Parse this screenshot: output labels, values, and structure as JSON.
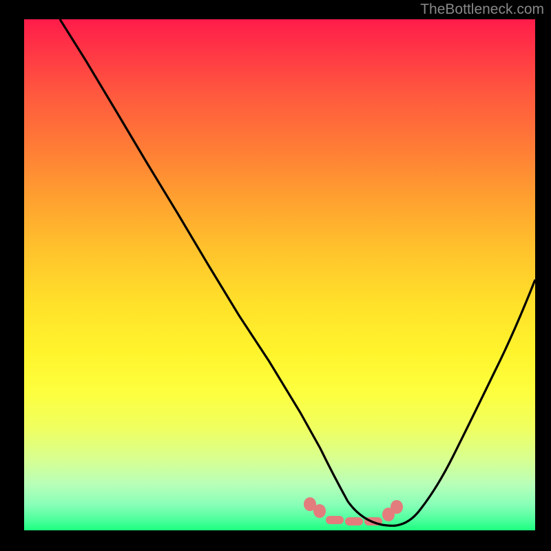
{
  "watermark": "TheBottleneck.com",
  "chart_data": {
    "type": "line",
    "title": "",
    "xlabel": "",
    "ylabel": "",
    "xlim": [
      0,
      100
    ],
    "ylim": [
      0,
      100
    ],
    "series": [
      {
        "name": "curve-left",
        "x": [
          7,
          12,
          18,
          24,
          30,
          36,
          42,
          48,
          54,
          58,
          62,
          66,
          70,
          72
        ],
        "values": [
          100,
          92,
          82,
          72,
          62,
          52,
          42,
          33,
          23,
          16,
          10,
          5,
          1.5,
          0.5
        ]
      },
      {
        "name": "curve-right",
        "x": [
          72,
          76,
          80,
          84,
          88,
          92,
          96,
          100
        ],
        "values": [
          0.5,
          1.5,
          5,
          11,
          19,
          29,
          41,
          55
        ]
      }
    ],
    "highlight_band": {
      "x_start": 56,
      "x_end": 73
    },
    "gradient_colors": {
      "top": "#ff1c4a",
      "mid": "#ffdf2a",
      "bottom": "#1bff7f"
    }
  }
}
